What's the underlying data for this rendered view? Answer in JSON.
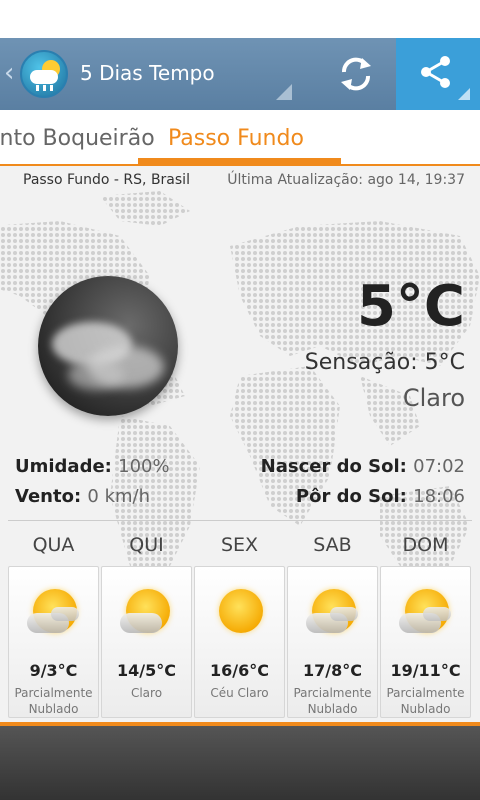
{
  "app": {
    "title": "5 Dias Tempo"
  },
  "tabs": [
    {
      "label": "ento Boqueirão"
    },
    {
      "label": "Passo Fundo"
    }
  ],
  "header": {
    "location": "Passo Fundo - RS, Brasil",
    "updated": "Última Atualização: ago 14, 19:37"
  },
  "current": {
    "temperature": "5°C",
    "feels_label": "Sensação:",
    "feels_value": "5°C",
    "condition": "Claro",
    "icon": "moon-clouds-icon"
  },
  "stats": {
    "humidity_label": "Umidade:",
    "humidity_value": "100%",
    "wind_label": "Vento:",
    "wind_value": "0 km/h",
    "sunrise_label": "Nascer do Sol:",
    "sunrise_value": "07:02",
    "sunset_label": "Pôr do Sol:",
    "sunset_value": "18:06"
  },
  "forecast": [
    {
      "day": "QUA",
      "temp": "9/3°C",
      "desc": "Parcialmente\nNublado",
      "icon": "partly-cloudy-icon"
    },
    {
      "day": "QUI",
      "temp": "14/5°C",
      "desc": "Claro",
      "icon": "partly-cloudy-icon"
    },
    {
      "day": "SEX",
      "temp": "16/6°C",
      "desc": "Céu Claro",
      "icon": "sun-icon"
    },
    {
      "day": "SAB",
      "temp": "17/8°C",
      "desc": "Parcialmente\nNublado",
      "icon": "partly-cloudy-icon"
    },
    {
      "day": "DOM",
      "temp": "19/11°C",
      "desc": "Parcialmente\nNublado",
      "icon": "partly-cloudy-icon"
    }
  ],
  "colors": {
    "accent": "#f08a1c",
    "action_bar": "#6489ad",
    "share_button": "#3b9fd9"
  }
}
